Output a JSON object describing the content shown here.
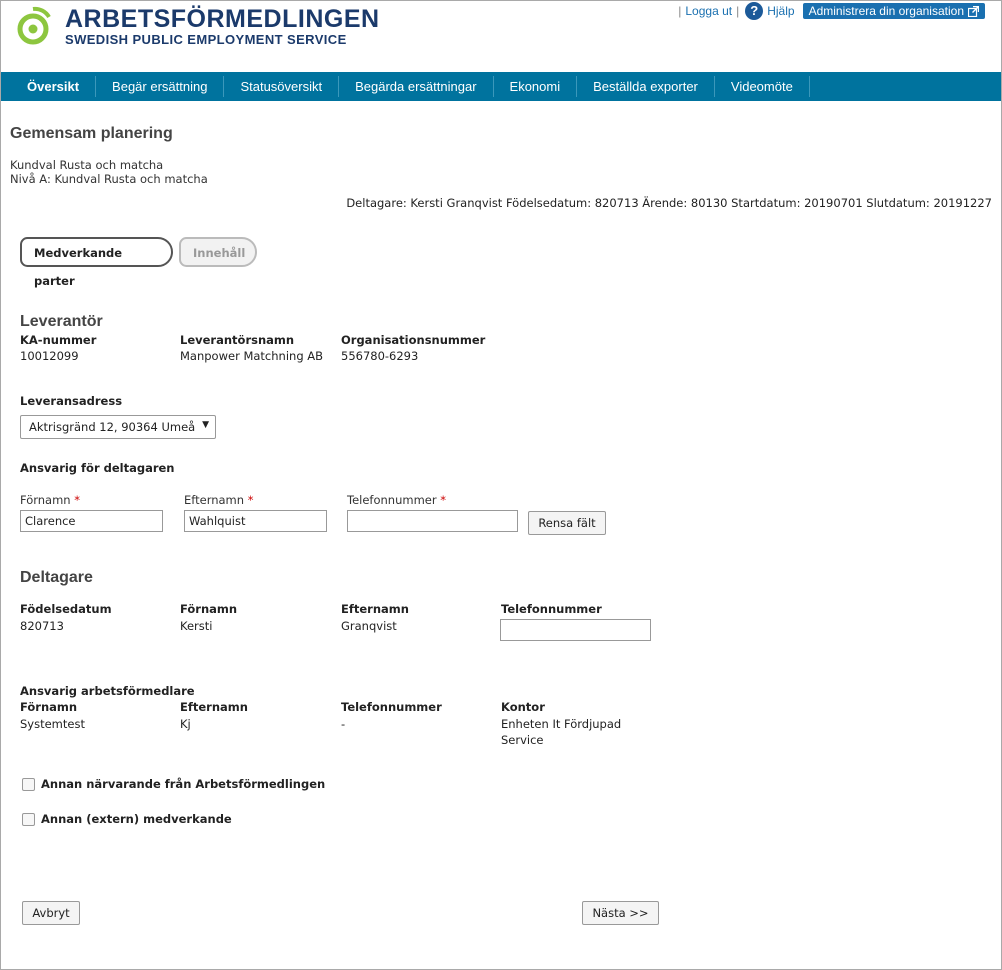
{
  "header": {
    "brand": "ARBETSFÖRMEDLINGEN",
    "brand_sub": "SWEDISH PUBLIC EMPLOYMENT SERVICE",
    "logout": "Logga ut",
    "help": "Hjälp",
    "admin": "Administrera din organisation",
    "brand_color": "#1b3a6b",
    "logo_color": "#8dc63f"
  },
  "nav": {
    "color": "#00739e",
    "items": [
      "Översikt",
      "Begär ersättning",
      "Statusöversikt",
      "Begärda ersättningar",
      "Ekonomi",
      "Beställda exporter",
      "Videomöte"
    ]
  },
  "page": {
    "title": "Gemensam planering",
    "line1": "Kundval Rusta och matcha",
    "line2": "Nivå A: Kundval Rusta och matcha",
    "participant_line": "Deltagare: Kersti Granqvist Födelsedatum: 820713 Ärende: 80130 Startdatum: 20190701 Slutdatum: 20191227"
  },
  "steps": [
    "Medverkande parter",
    "Innehåll"
  ],
  "leverantor": {
    "title": "Leverantör",
    "ka_label": "KA-nummer",
    "ka_value": "10012099",
    "name_label": "Leverantörsnamn",
    "name_value": "Manpower Matchning AB",
    "org_label": "Organisationsnummer",
    "org_value": "556780-6293",
    "address_label": "Leveransadress",
    "address_value": "Aktrisgränd 12, 90364 Umeå"
  },
  "ansvarig": {
    "title": "Ansvarig för deltagaren",
    "first_label": "Förnamn",
    "first_value": "Clarence",
    "last_label": "Efternamn",
    "last_value": "Wahlquist",
    "phone_label": "Telefonnummer",
    "phone_value": "",
    "required_mark": "*",
    "clear_button": "Rensa fält"
  },
  "deltagare": {
    "title": "Deltagare",
    "birth_label": "Födelsedatum",
    "birth_value": "820713",
    "first_label": "Förnamn",
    "first_value": "Kersti",
    "last_label": "Efternamn",
    "last_value": "Granqvist",
    "phone_label": "Telefonnummer",
    "phone_value": ""
  },
  "formedlare": {
    "title": "Ansvarig arbetsförmedlare",
    "first_label": "Förnamn",
    "first_value": "Systemtest",
    "last_label": "Efternamn",
    "last_value": "Kj",
    "phone_label": "Telefonnummer",
    "phone_value": "-",
    "office_label": "Kontor",
    "office_line1": "Enheten It Fördjupad",
    "office_line2": "Service"
  },
  "checkboxes": {
    "other_af": "Annan närvarande från Arbetsförmedlingen",
    "other_ext": "Annan (extern) medverkande"
  },
  "footer": {
    "cancel": "Avbryt",
    "next": "Nästa >>"
  }
}
